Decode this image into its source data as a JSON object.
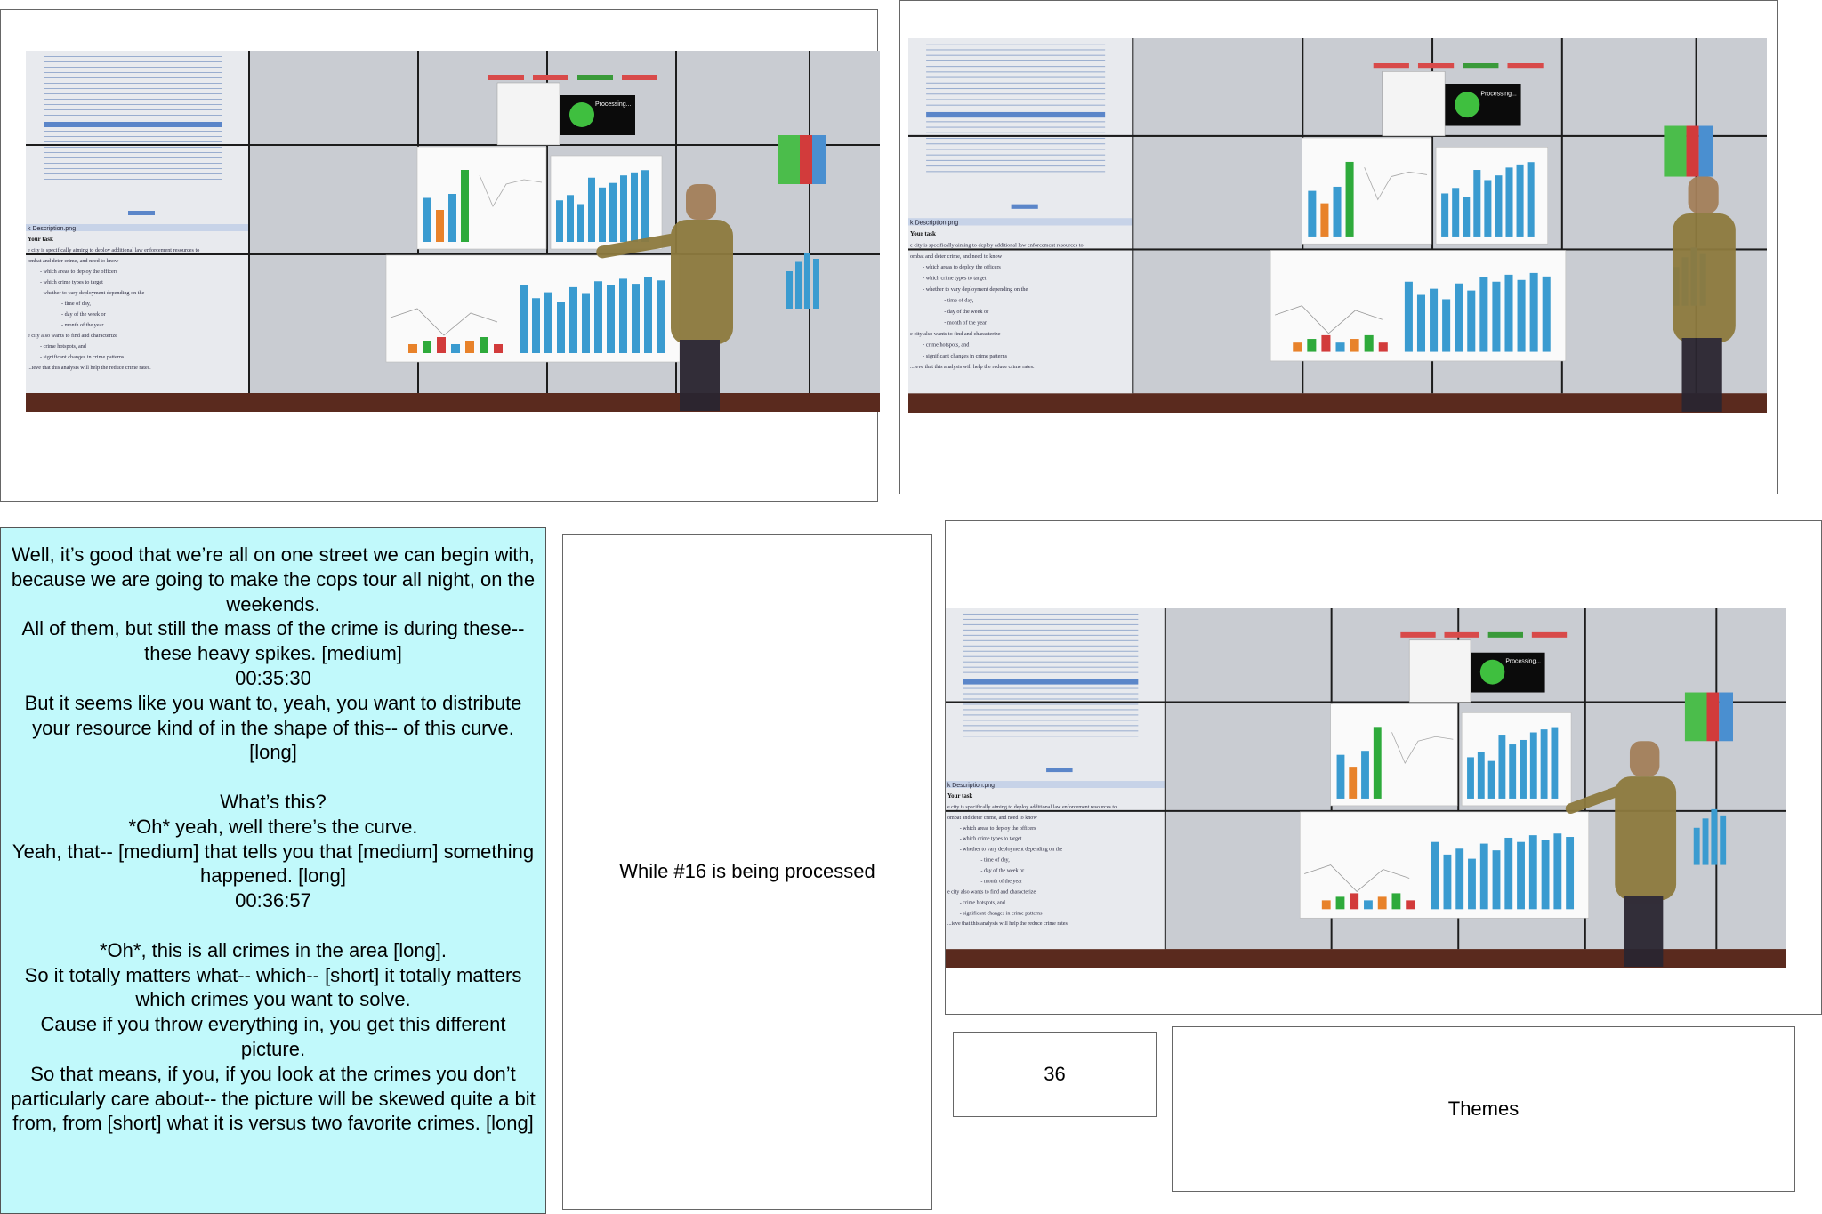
{
  "photos": [
    {
      "label": "Photo 1: presenter gesturing at the display wall"
    },
    {
      "label": "Photo 2: presenter standing at right edge of display wall"
    },
    {
      "label": "Photo 3: presenter pointing at the bar charts"
    }
  ],
  "wall": {
    "task_window_title": "k Description.png",
    "task_heading": "Your task",
    "task_lines": [
      "e city is specifically aiming to deploy additional law enforcement resources to",
      "ombat and deter crime, and need to know",
      "- which areas to deploy the officers",
      "- which crime types to target",
      "- whether to vary deployment depending on the",
      "- time of day,",
      "- day of the week or",
      "- month of the year",
      "e city also wants to find and characterize",
      "- crime hotspots, and",
      "- significant changes in crime patterns",
      "...ieve that this analysis will help the reduce crime rates."
    ],
    "processing_label": "Processing...",
    "bar_values": [
      0.55,
      0.62,
      0.5,
      0.85,
      0.72,
      0.78,
      0.88,
      0.92,
      0.95
    ],
    "bar_values_bottom": [
      0.8,
      0.65,
      0.72,
      0.6,
      0.78,
      0.7,
      0.85,
      0.8,
      0.88,
      0.82,
      0.9,
      0.86
    ],
    "colors": {
      "bar_blue": "#3a9bd0",
      "bar_orange": "#e8822a",
      "bar_green": "#2eaa3b",
      "bar_red": "#d23b3b",
      "panel": "#e8eaee",
      "screen": "#c9ccd2"
    }
  },
  "transcript": {
    "lines": [
      "Well, it’s good that we’re all on one street we can begin with, because we are going to make the cops tour all night, on the weekends.",
      "All of them, but still the mass of the crime is during these-- these heavy spikes. [medium]",
      "00:35:30",
      "But it seems like you want to, yeah, you want to distribute your resource kind of in the shape of this-- of this curve. [long]",
      "",
      "What’s this?",
      "*Oh* yeah, well there’s the curve.",
      "Yeah, that-- [medium] that tells you that [medium] something happened. [long]",
      "00:36:57",
      "",
      "*Oh*, this is all crimes in the area [long].",
      "So it totally matters what-- which-- [short] it totally matters which crimes you want to solve.",
      "Cause if you throw everything in, you get this different picture.",
      "So that means, if you, if you look at the crimes you don’t particularly care about-- the picture will be skewed quite a bit from, from [short] what it is versus two favorite crimes. [long]"
    ]
  },
  "status_box": {
    "text": "While #16 is being processed"
  },
  "number_box": {
    "text": "36"
  },
  "themes_box": {
    "text": "Themes"
  }
}
